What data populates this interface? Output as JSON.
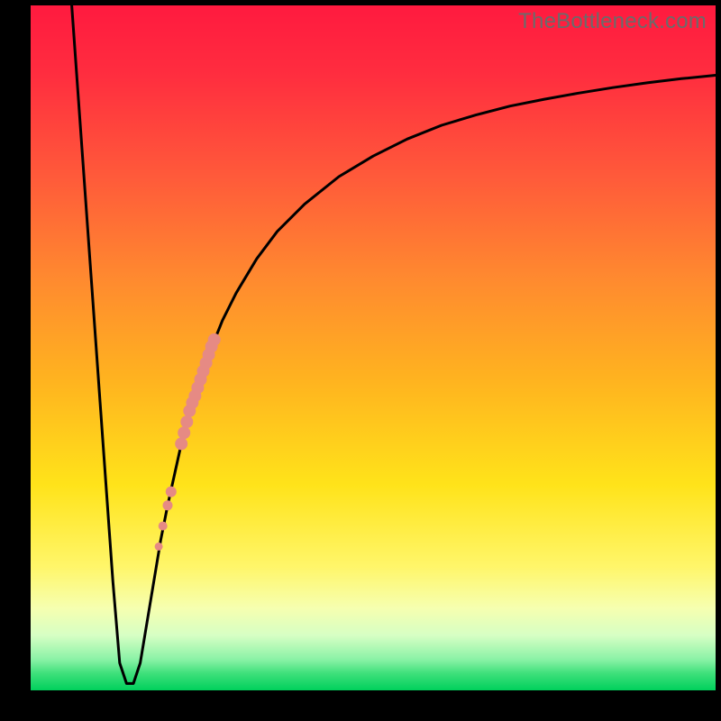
{
  "watermark": "TheBottleneck.com",
  "colors": {
    "frame": "#000000",
    "curve": "#000000",
    "dots": "#e68a84",
    "gradient_stops": [
      {
        "offset": 0.0,
        "color": "#ff1a3f"
      },
      {
        "offset": 0.1,
        "color": "#ff2d3f"
      },
      {
        "offset": 0.25,
        "color": "#ff5a3a"
      },
      {
        "offset": 0.4,
        "color": "#ff8a2f"
      },
      {
        "offset": 0.55,
        "color": "#ffb41f"
      },
      {
        "offset": 0.7,
        "color": "#ffe31a"
      },
      {
        "offset": 0.82,
        "color": "#fff66a"
      },
      {
        "offset": 0.88,
        "color": "#f6ffb0"
      },
      {
        "offset": 0.92,
        "color": "#d6ffc4"
      },
      {
        "offset": 0.955,
        "color": "#8af2a6"
      },
      {
        "offset": 0.975,
        "color": "#3fe07b"
      },
      {
        "offset": 1.0,
        "color": "#00d05c"
      }
    ]
  },
  "chart_data": {
    "type": "line",
    "title": "",
    "xlabel": "",
    "ylabel": "",
    "xlim": [
      0,
      100
    ],
    "ylim": [
      0,
      100
    ],
    "grid": false,
    "series": [
      {
        "name": "bottleneck-curve",
        "x": [
          6,
          7,
          8,
          9,
          10,
          11,
          12,
          13,
          14,
          15,
          16,
          17,
          18,
          19,
          20,
          22,
          24,
          26,
          28,
          30,
          33,
          36,
          40,
          45,
          50,
          55,
          60,
          65,
          70,
          75,
          80,
          85,
          90,
          95,
          100
        ],
        "y": [
          100,
          86,
          72,
          58,
          44,
          30,
          16,
          4,
          1,
          1,
          4,
          10,
          16,
          22,
          27,
          36,
          43,
          49,
          54,
          58,
          63,
          67,
          71,
          75,
          78,
          80.5,
          82.5,
          84,
          85.3,
          86.3,
          87.2,
          88,
          88.7,
          89.3,
          89.8
        ]
      }
    ],
    "dots": {
      "name": "highlight-dots",
      "x": [
        22.0,
        22.4,
        22.8,
        23.2,
        23.6,
        24.0,
        24.4,
        24.8,
        25.2,
        25.6,
        26.0,
        26.4,
        26.8,
        20.5,
        20.0,
        19.3,
        18.7
      ],
      "y": [
        36.0,
        37.6,
        39.2,
        40.8,
        42.0,
        43.0,
        44.2,
        45.4,
        46.6,
        47.8,
        49.0,
        50.2,
        51.2,
        29.0,
        27.0,
        24.0,
        21.0
      ],
      "r": [
        7,
        7,
        7,
        7,
        7,
        7,
        7,
        7,
        7,
        7,
        7,
        7,
        7,
        6,
        5.5,
        5,
        4.5
      ]
    }
  }
}
